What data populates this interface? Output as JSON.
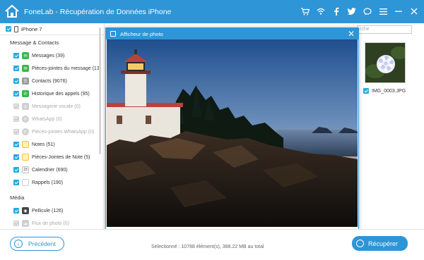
{
  "app": {
    "title": "FoneLab - Récupération de Données iPhone",
    "accent_color": "#2e95d6",
    "title_icons": [
      "cart-icon",
      "wifi-icon",
      "facebook-icon",
      "twitter-icon",
      "chat-icon",
      "menu-icon",
      "minimize-icon",
      "close-icon"
    ]
  },
  "sidebar": {
    "device": "iPhone 7",
    "sections": [
      {
        "title": "Message & Contacts",
        "items": [
          {
            "label": "Messages (39)",
            "checked": true,
            "enabled": true,
            "icon": "message-icon"
          },
          {
            "label": "Pièces-jointes du message (13)",
            "checked": true,
            "enabled": true,
            "icon": "attachment-icon"
          },
          {
            "label": "Contacts (9076)",
            "checked": true,
            "enabled": true,
            "icon": "contacts-icon"
          },
          {
            "label": "Historique des appels (95)",
            "checked": true,
            "enabled": true,
            "icon": "phone-icon"
          },
          {
            "label": "Messagerie vocale (0)",
            "checked": false,
            "enabled": false,
            "icon": "voicemail-icon"
          },
          {
            "label": "WhatsApp (0)",
            "checked": false,
            "enabled": false,
            "icon": "whatsapp-icon"
          },
          {
            "label": "Pièces-jointes WhatsApp (0)",
            "checked": false,
            "enabled": false,
            "icon": "whatsapp-attachment-icon"
          },
          {
            "label": "Notes (51)",
            "checked": true,
            "enabled": true,
            "icon": "notes-icon"
          },
          {
            "label": "Pièces-Jointes de Note (5)",
            "checked": true,
            "enabled": true,
            "icon": "note-attachment-icon"
          },
          {
            "label": "Calendrier (690)",
            "checked": true,
            "enabled": true,
            "icon": "calendar-icon"
          },
          {
            "label": "Rappels (190)",
            "checked": true,
            "enabled": true,
            "icon": "reminders-icon"
          }
        ]
      },
      {
        "title": "Média",
        "items": [
          {
            "label": "Pellicule (126)",
            "checked": true,
            "enabled": true,
            "icon": "camera-roll-icon"
          },
          {
            "label": "Flux de photo (0)",
            "checked": false,
            "enabled": false,
            "icon": "photo-stream-icon"
          }
        ]
      }
    ]
  },
  "content": {
    "search_placeholder": "rche",
    "thumbnail_label": "IMG_0003.JPG"
  },
  "viewer": {
    "title": "Afficheur de photo",
    "buttons": [
      "previous-icon",
      "next-icon",
      "rotate-left-icon",
      "rotate-right-icon"
    ]
  },
  "bottom": {
    "prev_label": "Précédent",
    "recover_label": "Récupérer",
    "status_text": "Sélectionné : 10788 élément(s), 388.22 MB au total"
  }
}
